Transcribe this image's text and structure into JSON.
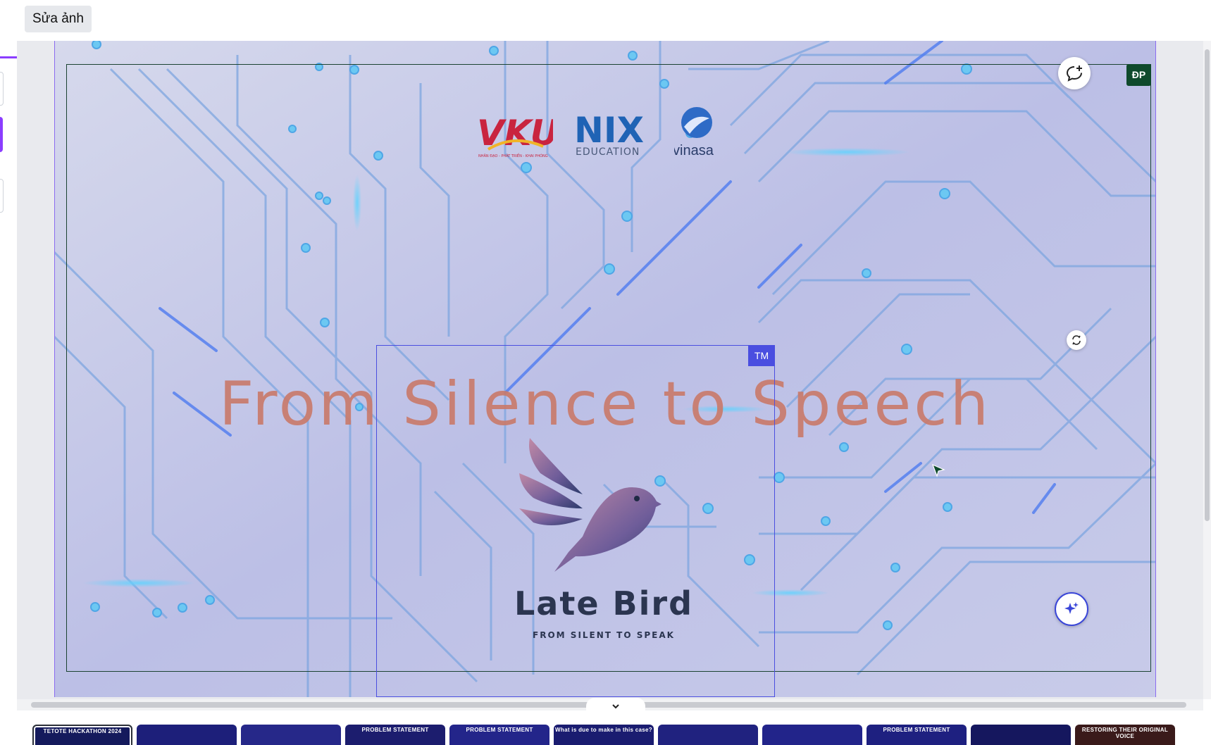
{
  "toolbar": {
    "edit_image_label": "Sửa ảnh"
  },
  "slide": {
    "title": "From Silence to Speech",
    "collaborator_badge_1": "ĐP",
    "collaborator_badge_2": "TM",
    "logos": {
      "vku": "VKU",
      "vku_sub": "NHÂN ĐẠO - PHÁT TRIỂN - KHAI PHÓNG",
      "nix": "NIX",
      "nix_sub": "EDUCATION",
      "vinasa": "vinasa"
    },
    "brand_name": "Late Bird",
    "brand_tagline": "FROM SILENT TO SPEAK"
  },
  "filmstrip": {
    "thumbnails": [
      {
        "label": "TETOTE HACKATHON 2024",
        "bg": "#141a5c",
        "active": true
      },
      {
        "label": "",
        "bg": "#1d1f7a",
        "active": false
      },
      {
        "label": "",
        "bg": "#262889",
        "active": false
      },
      {
        "label": "PROBLEM STATEMENT",
        "bg": "#1c1d6e",
        "active": false
      },
      {
        "label": "PROBLEM STATEMENT",
        "bg": "#23258a",
        "active": false
      },
      {
        "label": "What is due to make in this case?",
        "bg": "#1a1c70",
        "active": false
      },
      {
        "label": "",
        "bg": "#20227f",
        "active": false
      },
      {
        "label": "",
        "bg": "#22248a",
        "active": false
      },
      {
        "label": "PROBLEM STATEMENT",
        "bg": "#1e2080",
        "active": false
      },
      {
        "label": "",
        "bg": "#15175e",
        "active": false
      },
      {
        "label": "RESTORING THEIR ORIGINAL VOICE",
        "bg": "#3a1a1a",
        "active": false
      }
    ]
  },
  "colors": {
    "accent": "#8b3dff",
    "selection_green": "#0f4a2c",
    "selection_blue": "#4a4ee0",
    "title_color": "#c97b6c"
  }
}
